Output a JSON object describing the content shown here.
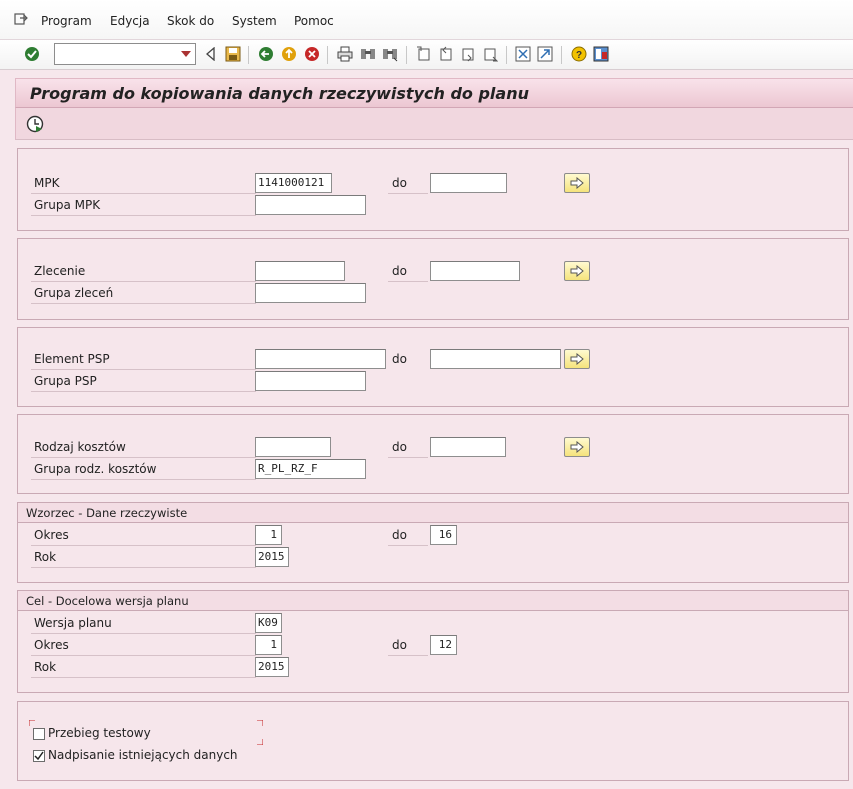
{
  "menubar": {
    "items": [
      {
        "label": "Program"
      },
      {
        "label": "Edycja"
      },
      {
        "label": "Skok do"
      },
      {
        "label": "System"
      },
      {
        "label": "Pomoc"
      }
    ]
  },
  "toolbar": {
    "command_field": "",
    "icons": [
      "enter-icon",
      "back-arrow-icon",
      "save-icon",
      "back-icon",
      "exit-icon",
      "cancel-icon",
      "print-icon",
      "find-icon",
      "find-next-icon",
      "first-page-icon",
      "prev-page-icon",
      "next-page-icon",
      "last-page-icon",
      "new-session-icon",
      "shortcut-icon",
      "help-icon",
      "layout-icon"
    ]
  },
  "title": "Program do kopiowania danych rzeczywistych do planu",
  "app_toolbar": {
    "execute_icon": "execute-icon"
  },
  "blocks": {
    "mpk": {
      "label": "MPK",
      "from": "1141000121",
      "to_label": "do",
      "to": "",
      "group_label": "Grupa MPK",
      "group": ""
    },
    "zlecenie": {
      "label": "Zlecenie",
      "from": "",
      "to_label": "do",
      "to": "",
      "group_label": "Grupa zleceń",
      "group": ""
    },
    "psp": {
      "label": "Element PSP",
      "from": "",
      "to_label": "do",
      "to": "",
      "group_label": "Grupa PSP",
      "group": ""
    },
    "rodzaj": {
      "label": "Rodzaj kosztów",
      "from": "",
      "to_label": "do",
      "to": "",
      "group_label": "Grupa rodz. kosztów",
      "group": "R_PL_RZ_F"
    }
  },
  "wzorzec": {
    "title": "Wzorzec - Dane rzeczywiste",
    "okres_label": "Okres",
    "okres_from": "1",
    "to_label": "do",
    "okres_to": "16",
    "rok_label": "Rok",
    "rok": "2015"
  },
  "cel": {
    "title": "Cel - Docelowa wersja planu",
    "wersja_label": "Wersja planu",
    "wersja": "K09",
    "okres_label": "Okres",
    "okres_from": "1",
    "to_label": "do",
    "okres_to": "12",
    "rok_label": "Rok",
    "rok": "2015"
  },
  "options": {
    "test_run_label": "Przebieg testowy",
    "test_run_checked": false,
    "overwrite_label": "Nadpisanie istniejących danych",
    "overwrite_checked": true
  },
  "colors": {
    "accent": "#f5e37c",
    "title_bg": "#ecc7d2",
    "page_bg": "#f6e7ec"
  }
}
